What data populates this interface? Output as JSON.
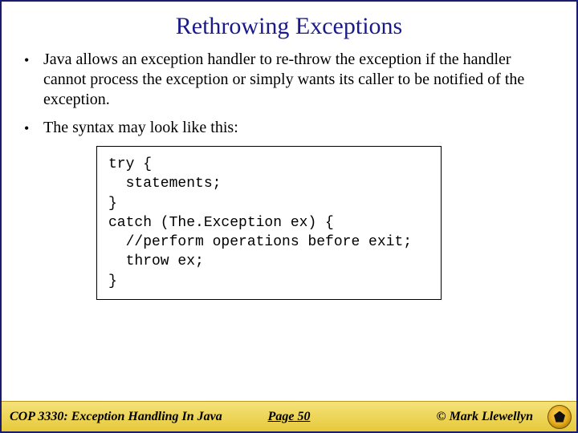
{
  "title": "Rethrowing Exceptions",
  "bullets": [
    "Java allows an exception handler to re-throw the exception if the handler cannot process the exception or simply wants its caller to be notified of the exception.",
    "The syntax may look like this:"
  ],
  "code": "try {\n  statements;\n}\ncatch (The.Exception ex) {\n  //perform operations before exit;\n  throw ex;\n}",
  "footer": {
    "course": "COP 3330:  Exception Handling In Java",
    "page": "Page 50",
    "copyright": "© Mark Llewellyn"
  }
}
